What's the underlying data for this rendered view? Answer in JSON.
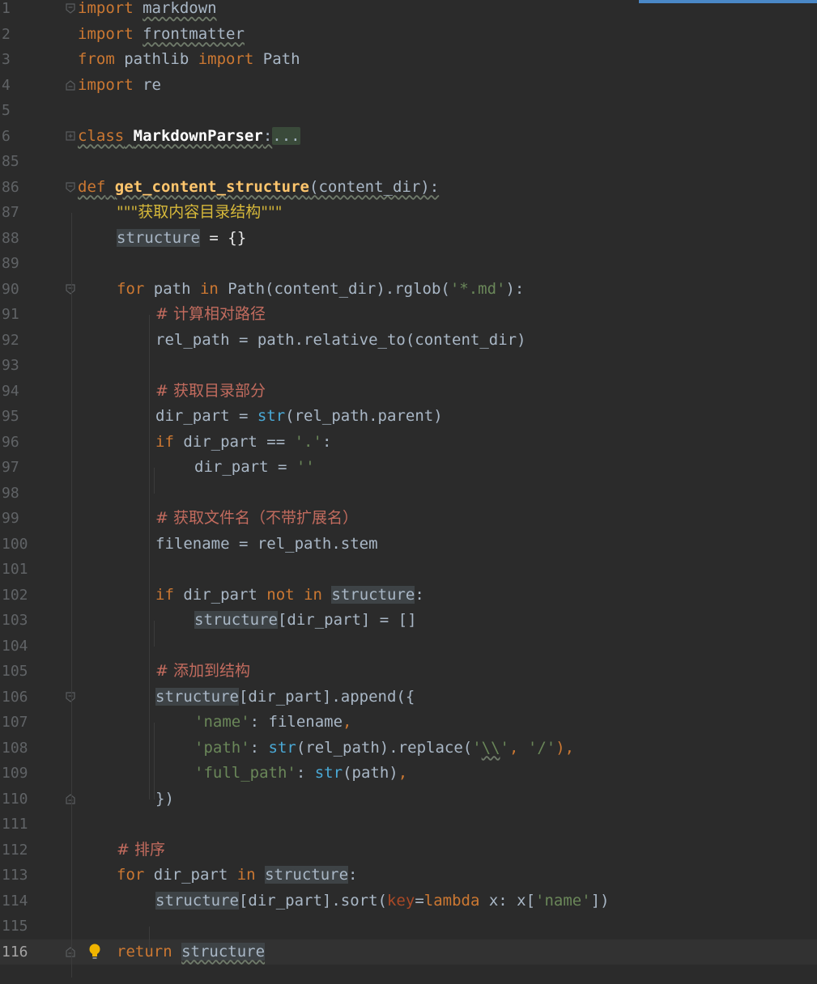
{
  "editor": {
    "line_numbers": [
      "1",
      "2",
      "3",
      "4",
      "5",
      "6",
      "85",
      "86",
      "87",
      "88",
      "89",
      "90",
      "91",
      "92",
      "93",
      "94",
      "95",
      "96",
      "97",
      "98",
      "99",
      "100",
      "101",
      "102",
      "103",
      "104",
      "105",
      "106",
      "107",
      "108",
      "109",
      "110",
      "111",
      "112",
      "113",
      "114",
      "115",
      "116"
    ],
    "tokens": {
      "import": "import",
      "from": "from",
      "markdown": "markdown",
      "frontmatter": "frontmatter",
      "pathlib": "pathlib",
      "Path": "Path",
      "re": "re",
      "class": "class",
      "class_name": "MarkdownParser",
      "colon": ":",
      "folded": "...",
      "def": "def",
      "func_name": "get_content_structure",
      "param_sig": "(content_dir):",
      "docstring": "\"\"\"获取内容目录结构\"\"\"",
      "structure": "structure",
      "assign_dict": " = {}",
      "for": "for",
      "in": "in",
      "if": "if",
      "not": "not",
      "return": "return",
      "lambda": "lambda",
      "key": "key",
      "str": "str",
      "comment_1": "# 计算相对路径",
      "comment_2": "# 获取目录部分",
      "comment_3": "# 获取文件名（不带扩展名）",
      "comment_4": "# 添加到结构",
      "comment_5": "# 排序",
      "glob": "'*.md'",
      "dot": "'.'",
      "empty": "''",
      "name_key": "'name'",
      "path_key": "'path'",
      "full_path_key": "'full_path'",
      "backslash": "\\\\",
      "slash": "'/'"
    }
  },
  "colors": {
    "background": "#2b2b2b",
    "keyword": "#cc7832",
    "function": "#ffc66d",
    "string": "#6a8759",
    "comment": "#c26b5e",
    "builtin": "#4aa9d6",
    "text": "#a9b7c6",
    "line_number": "#606366"
  },
  "icons": {
    "fold": "fold-marker-icon",
    "bulb": "lightbulb-icon"
  }
}
